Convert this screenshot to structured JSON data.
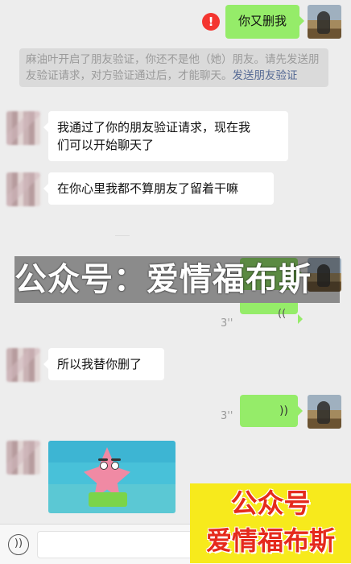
{
  "messages": {
    "sent_1": {
      "text": "你又删我",
      "status": "!"
    },
    "notice": {
      "text": "麻油叶开启了朋友验证，你还不是他（她）朋友。请先发送朋友验证请求，对方验证通过后，才能聊天。",
      "link": "发送朋友验证"
    },
    "received_1": {
      "line1": "我通过了你的朋友验证请求，现在我",
      "line2": "们可以开始聊天了"
    },
    "received_2": {
      "text": "在你心里我都不算朋友了留着干嘛"
    },
    "voice_1": {
      "duration": "3''"
    },
    "received_3": {
      "text": "所以我替你删了"
    },
    "voice_2": {
      "duration": "3''"
    }
  },
  "watermark": {
    "text": "公众号：爱情福布斯"
  },
  "promo": {
    "line1": "公众号",
    "line2": "爱情福布斯"
  },
  "input_bar": {
    "voice_toggle_icon": "voice-toggle-icon"
  },
  "colors": {
    "background": "#ededed",
    "sent_bubble": "#95ec69",
    "received_bubble": "#ffffff",
    "link": "#576b95",
    "error": "#f43530",
    "promo_background": "#f7ea1c",
    "promo_text": "#e52a1c"
  }
}
